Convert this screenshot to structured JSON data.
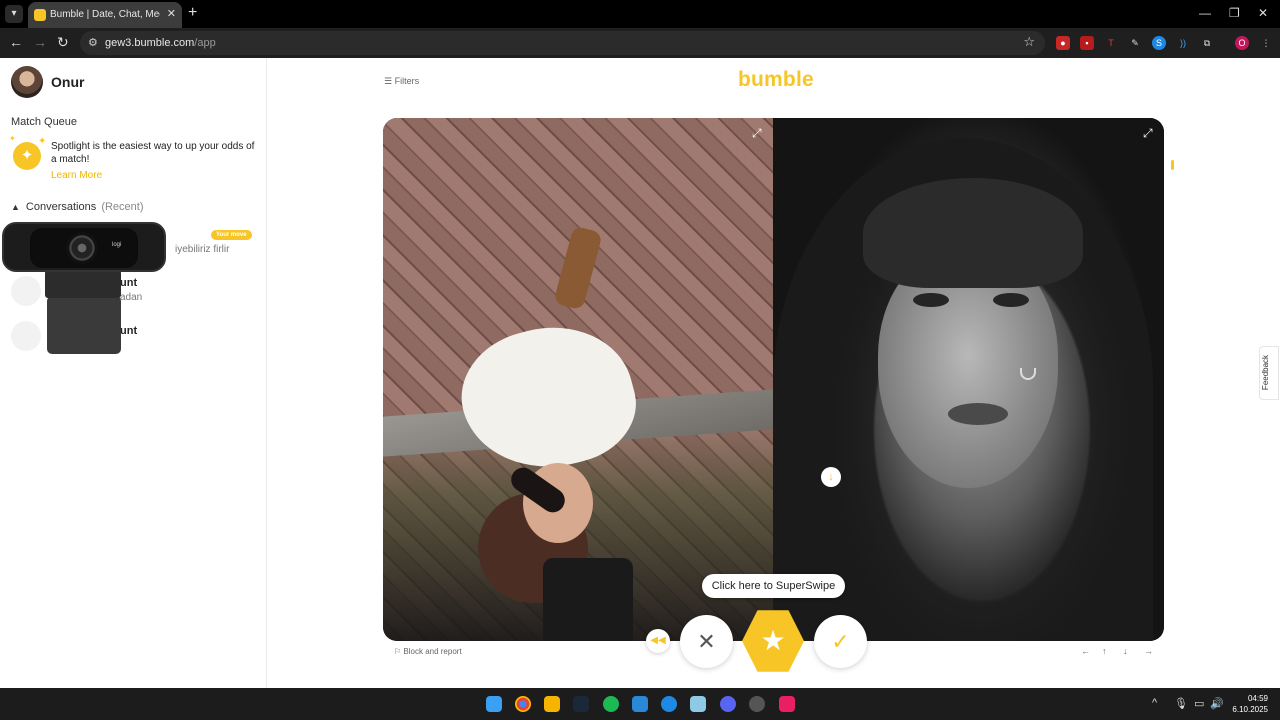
{
  "browser": {
    "tab_title": "Bumble | Date, Chat, Meet New",
    "tab_close": "✕",
    "new_tab": "+",
    "url_host": "gew3.bumble.com",
    "url_path": "/app",
    "window_controls": [
      "—",
      "❐",
      "✕"
    ],
    "profile_initial": "O"
  },
  "sidebar": {
    "user_name": "Onur",
    "match_queue_title": "Match Queue",
    "spotlight_text": "Spotlight is the easiest way to up your odds of a match!",
    "learn_more": "Learn More",
    "conversations_title": "Conversations",
    "conversations_recent": "(Recent)",
    "your_move_badge": "Your move",
    "conversations": [
      {
        "preview": "iyebiliriz firlir"
      },
      {
        "name": "unt",
        "preview": "adan"
      },
      {
        "name": "unt"
      }
    ],
    "webcam_brand": "logi"
  },
  "main": {
    "filters_label": "Filters",
    "logo_text": "bumble",
    "superswipe_tooltip": "Click here to SuperSwipe",
    "block_report": "Block and report",
    "keyboard_hints": [
      "←",
      "↑",
      "↓",
      "→"
    ],
    "feedback_label": "Feedback"
  },
  "taskbar": {
    "time": "04:59",
    "date": "6.10.2025"
  },
  "colors": {
    "brand_yellow": "#f7c626",
    "chrome_dark": "#1f1f1f",
    "taskbar": "#1c1c1c"
  }
}
